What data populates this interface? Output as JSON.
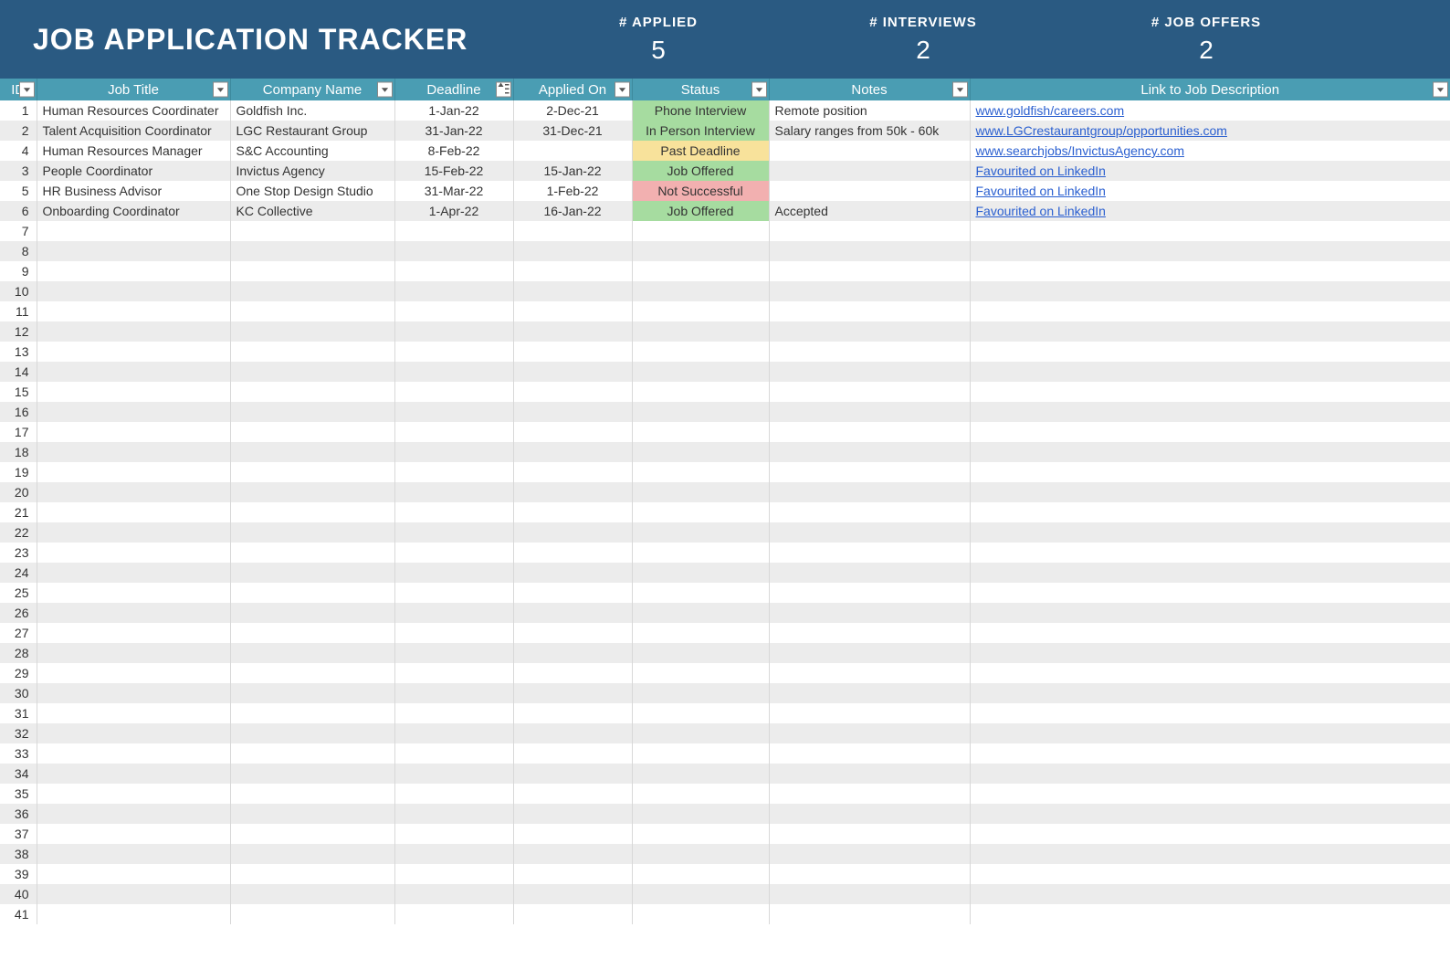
{
  "header": {
    "title": "JOB APPLICATION TRACKER",
    "stats": {
      "applied": {
        "label": "# APPLIED",
        "value": "5"
      },
      "interviews": {
        "label": "# INTERVIEWS",
        "value": "2"
      },
      "offers": {
        "label": "# JOB OFFERS",
        "value": "2"
      }
    }
  },
  "columns": {
    "id": "ID",
    "title": "Job Title",
    "company": "Company Name",
    "deadline": "Deadline",
    "applied": "Applied On",
    "status": "Status",
    "notes": "Notes",
    "link": "Link to Job Description"
  },
  "status_colors": {
    "Phone Interview": "green",
    "In Person Interview": "green",
    "Past Deadline": "yellow",
    "Job Offered": "green",
    "Not Successful": "red"
  },
  "rows": [
    {
      "id": "1",
      "title": "Human Resources Coordinater",
      "company": "Goldfish Inc.",
      "deadline": "1-Jan-22",
      "applied": "2-Dec-21",
      "status": "Phone Interview",
      "notes": "Remote position",
      "link": "www.goldfish/careers.com"
    },
    {
      "id": "2",
      "title": "Talent Acquisition Coordinator",
      "company": "LGC Restaurant Group",
      "deadline": "31-Jan-22",
      "applied": "31-Dec-21",
      "status": "In Person Interview",
      "notes": "Salary ranges from 50k - 60k",
      "link": "www.LGCrestaurantgroup/opportunities.com"
    },
    {
      "id": "4",
      "title": "Human Resources Manager",
      "company": "S&C Accounting",
      "deadline": "8-Feb-22",
      "applied": "",
      "status": "Past Deadline",
      "notes": "",
      "link": "www.searchjobs/InvictusAgency.com"
    },
    {
      "id": "3",
      "title": "People Coordinator",
      "company": "Invictus Agency",
      "deadline": "15-Feb-22",
      "applied": "15-Jan-22",
      "status": "Job Offered",
      "notes": "",
      "link": "Favourited on LinkedIn"
    },
    {
      "id": "5",
      "title": "HR Business Advisor",
      "company": "One Stop Design Studio",
      "deadline": "31-Mar-22",
      "applied": "1-Feb-22",
      "status": "Not Successful",
      "notes": "",
      "link": "Favourited on LinkedIn"
    },
    {
      "id": "6",
      "title": "Onboarding Coordinator",
      "company": "KC Collective",
      "deadline": "1-Apr-22",
      "applied": "16-Jan-22",
      "status": "Job Offered",
      "notes": "Accepted",
      "link": "Favourited on LinkedIn"
    }
  ],
  "empty_rows_start": 7,
  "empty_rows_end": 41
}
